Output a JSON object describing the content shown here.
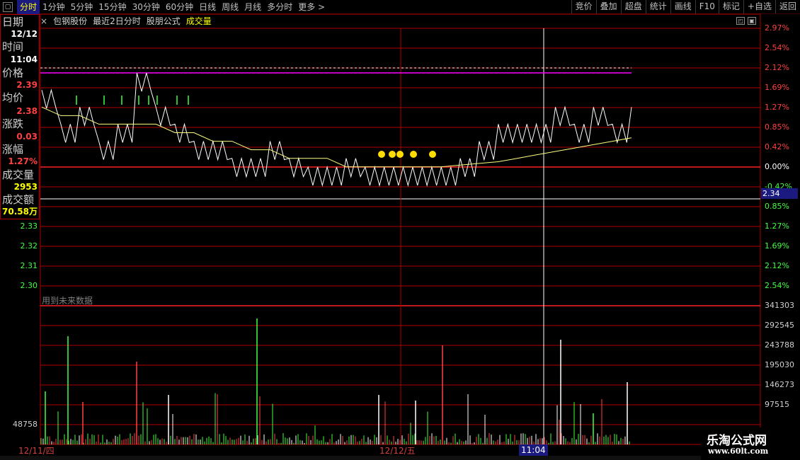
{
  "toolbar": {
    "periods": [
      "分时",
      "1分钟",
      "5分钟",
      "15分钟",
      "30分钟",
      "60分钟",
      "日线",
      "周线",
      "月线",
      "多分时",
      "更多 >"
    ],
    "right_buttons": [
      "竞价",
      "叠加",
      "超盘",
      "统计",
      "画线",
      "F10",
      "标记",
      "+自选",
      "返回"
    ]
  },
  "title_bar": {
    "close": "×",
    "stock": "包钢股份",
    "desc": "最近2日分时",
    "formula": "股朋公式",
    "vol": "成交量"
  },
  "info_panel": {
    "date_label": "日期",
    "date_value": "12/12",
    "time_label": "时间",
    "time_value": "11:04",
    "price_label": "价格",
    "price_value": "2.39",
    "avg_label": "均价",
    "avg_value": "2.38",
    "change_label": "涨跌",
    "change_value": "0.03",
    "pct_label": "涨幅",
    "pct_value": "1.27%",
    "vol_label": "成交量",
    "vol_value": "2953",
    "amount_label": "成交额",
    "amount_value": "70.58万"
  },
  "right_axis_upper": [
    "2.97%",
    "2.54%",
    "2.12%",
    "1.69%",
    "1.27%",
    "0.85%",
    "0.42%",
    "0.00%",
    "-0.42%"
  ],
  "right_axis_lower": [
    "0.85%",
    "1.27%",
    "1.69%",
    "2.12%",
    "2.54%"
  ],
  "left_axis_lower": [
    "2.33",
    "2.32",
    "2.31",
    "2.30"
  ],
  "volume_axis": [
    "341303",
    "292545",
    "243788",
    "195030",
    "146273",
    "97515",
    "48758"
  ],
  "future_note": "用到未来数据",
  "dates": [
    "12/11/四",
    "12/12/五"
  ],
  "cursor_time": "11:04",
  "cursor_price": "2.34",
  "watermark": {
    "title": "乐淘公式网",
    "url": "www.60lt.com"
  },
  "colors": {
    "grid": "#b00000",
    "price_line": "#ffffff",
    "avg_line": "#ffff80",
    "prev_close_line": "#ff00ff",
    "up": "#ff4040",
    "down": "#40ff40",
    "marker": "#ffdd00"
  },
  "chart_data": {
    "type": "line",
    "series": [
      {
        "values": [
          2.4,
          2.38,
          2.39,
          2.37,
          2.38,
          2.41,
          2.39,
          2.38,
          2.37,
          2.37,
          2.36,
          2.36,
          2.37,
          2.36,
          2.35,
          2.35,
          2.36,
          2.35,
          2.35,
          2.34,
          2.34,
          2.35,
          2.36,
          2.37,
          2.38,
          2.38,
          2.38,
          2.39,
          2.38,
          2.39,
          2.38,
          2.39
        ]
      },
      {
        "values": [
          2.39,
          2.385,
          2.385,
          2.38,
          2.38,
          2.38,
          2.38,
          2.375,
          2.375,
          2.37,
          2.37,
          2.365,
          2.365,
          2.36,
          2.36,
          2.36,
          2.355,
          2.355,
          2.355,
          2.355,
          2.355,
          2.355,
          2.356,
          2.357,
          2.358,
          2.36,
          2.362,
          2.364,
          2.366,
          2.368,
          2.37,
          2.372
        ]
      }
    ],
    "ylim": [
      2.33,
      2.42
    ]
  }
}
